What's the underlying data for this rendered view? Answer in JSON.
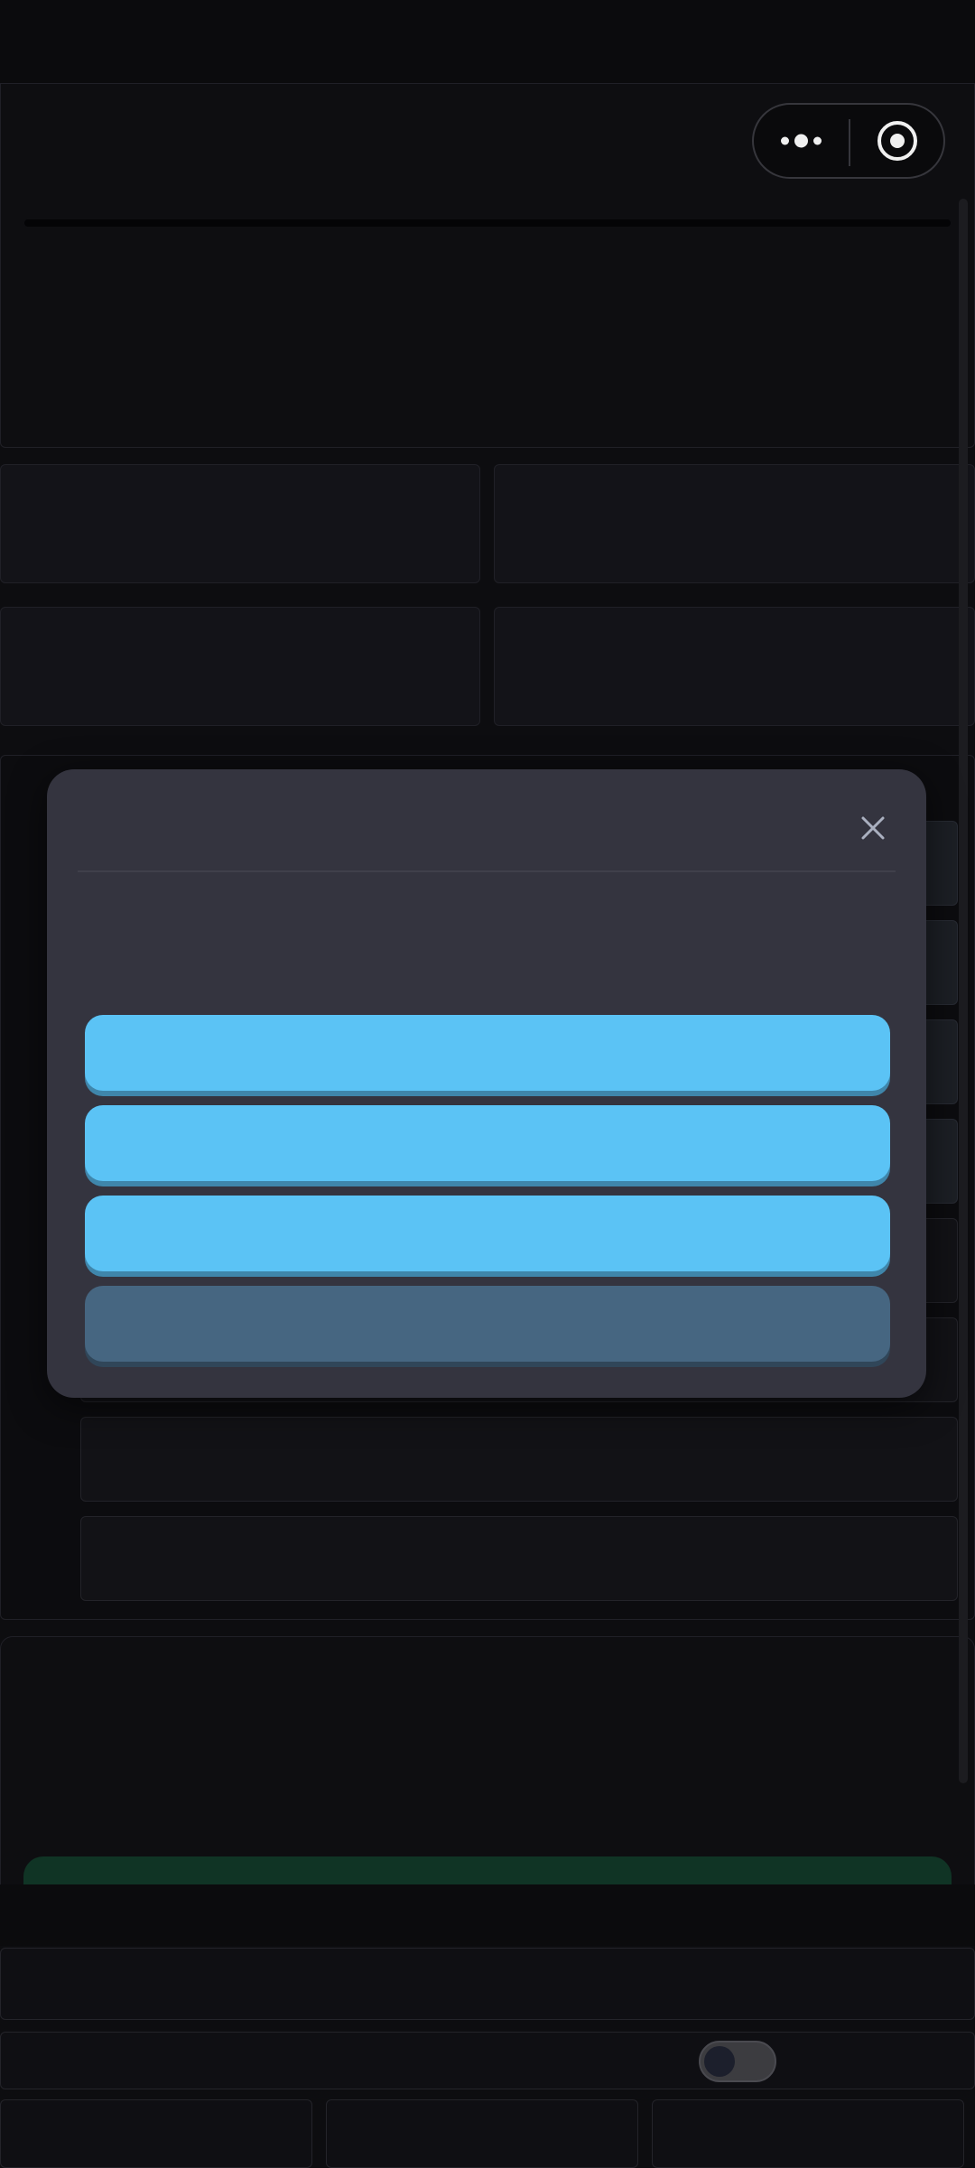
{
  "capsule": {
    "more_icon": "more-dots-icon",
    "close_icon": "target-circle-icon"
  },
  "modal": {
    "close_icon": "close-x-icon",
    "options": [
      {
        "label": "",
        "style": "primary"
      },
      {
        "label": "",
        "style": "primary"
      },
      {
        "label": "",
        "style": "primary"
      },
      {
        "label": "",
        "style": "secondary"
      }
    ]
  },
  "settings": {
    "toggle": {
      "on": false
    }
  },
  "colors": {
    "background": "#0e0e12",
    "modal": "#34343f",
    "primary_button": "#5bc3f5",
    "secondary_button": "#466681",
    "green_action": "#123828"
  }
}
